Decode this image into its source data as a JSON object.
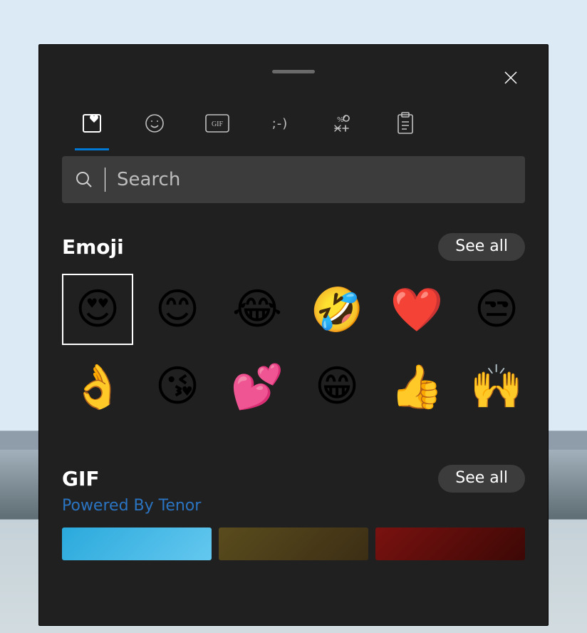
{
  "tabs": [
    {
      "name": "favorites",
      "kind": "icon"
    },
    {
      "name": "emoji",
      "kind": "icon"
    },
    {
      "name": "gif",
      "kind": "icon",
      "label": "GIF"
    },
    {
      "name": "kaomoji",
      "kind": "text",
      "label": ";-)"
    },
    {
      "name": "symbols",
      "kind": "icon"
    },
    {
      "name": "clipboard",
      "kind": "icon"
    }
  ],
  "active_tab": 0,
  "search": {
    "placeholder": "Search",
    "value": ""
  },
  "sections": {
    "emoji": {
      "title": "Emoji",
      "see_all": "See all",
      "items": [
        {
          "name": "smiling-face-heart-eyes",
          "glyph": "😍",
          "selected": true
        },
        {
          "name": "smiling-face-blush",
          "glyph": "😊"
        },
        {
          "name": "face-tears-of-joy",
          "glyph": "😂"
        },
        {
          "name": "rolling-on-floor-laughing",
          "glyph": "🤣"
        },
        {
          "name": "red-heart",
          "glyph": "❤️"
        },
        {
          "name": "unamused-face",
          "glyph": "😒"
        },
        {
          "name": "ok-hand",
          "glyph": "👌"
        },
        {
          "name": "face-blowing-kiss",
          "glyph": "😘"
        },
        {
          "name": "two-hearts",
          "glyph": "💕"
        },
        {
          "name": "beaming-face",
          "glyph": "😁"
        },
        {
          "name": "thumbs-up",
          "glyph": "👍"
        },
        {
          "name": "raising-hands",
          "glyph": "🙌"
        }
      ]
    },
    "gif": {
      "title": "GIF",
      "see_all": "See all",
      "attribution": "Powered By Tenor"
    }
  }
}
